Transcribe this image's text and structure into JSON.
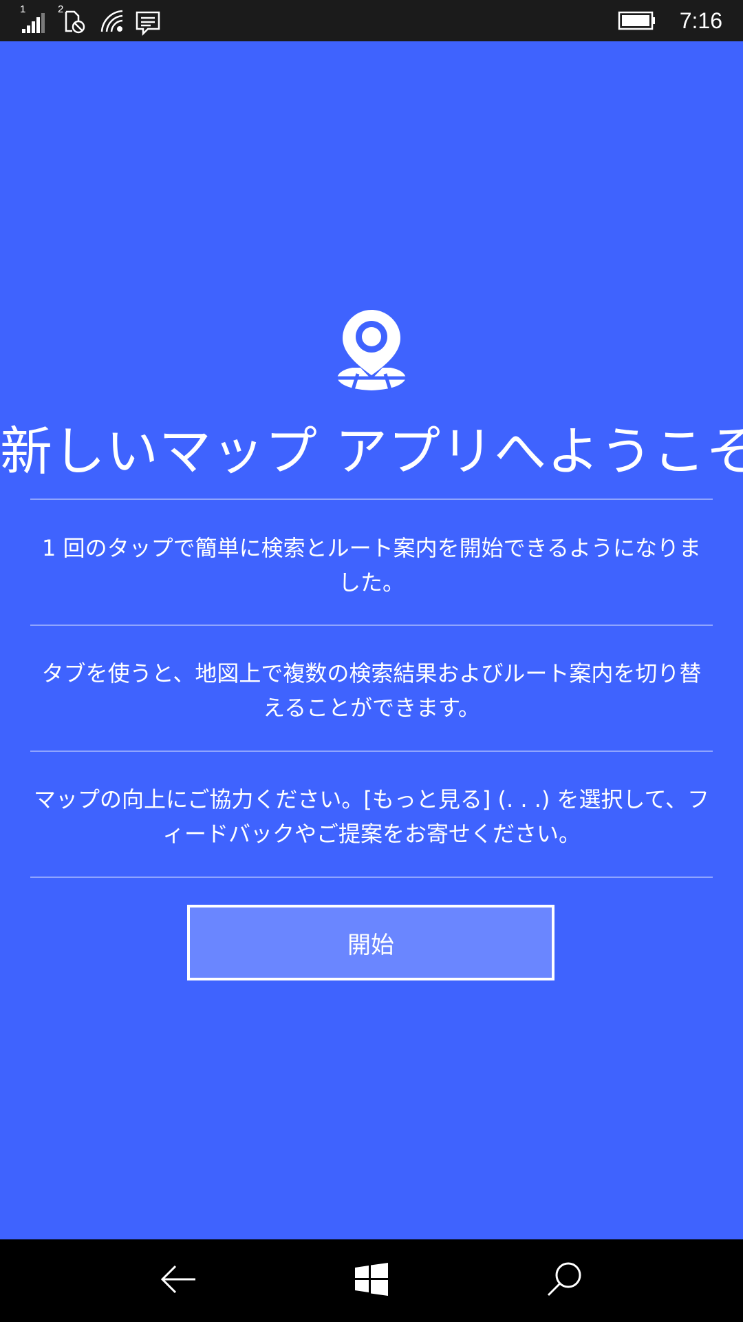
{
  "status_bar": {
    "sim1_label": "1",
    "sim2_label": "2",
    "time": "7:16",
    "icons": [
      "signal-icon",
      "no-sim-icon",
      "wifi-icon",
      "notification-icon",
      "battery-icon"
    ]
  },
  "welcome": {
    "title": "新しいマップ アプリへようこそ",
    "paragraphs": [
      "1 回のタップで簡単に検索とルート案内を開始できるようになりました。",
      "タブを使うと、地図上で複数の検索結果およびルート案内を切り替えることができます。",
      "マップの向上にご協力ください。[もっと見る] (. . .) を選択して、フィードバックやご提案をお寄せください。"
    ],
    "start_button": "開始"
  },
  "nav_bar": {
    "buttons": [
      "back-icon",
      "windows-icon",
      "search-icon"
    ]
  },
  "colors": {
    "background": "#3f63fe",
    "button_fill": "#6a86ff",
    "status_bar": "#1b1b1b",
    "nav_bar": "#000000"
  }
}
